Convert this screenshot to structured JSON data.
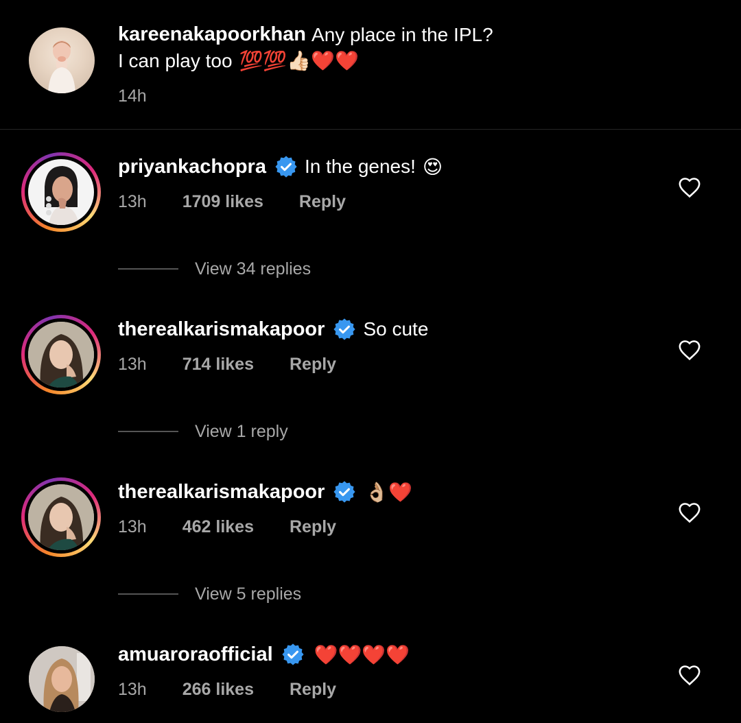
{
  "caption": {
    "username": "kareenakapoorkhan",
    "text_line1": "Any place in the IPL?",
    "text_line2": "I can play too",
    "emojis": "💯💯👍🏻❤️❤️",
    "time": "14h"
  },
  "comments": [
    {
      "username": "priyankachopra",
      "verified": true,
      "text": "In the genes!",
      "emoji": "😍",
      "time": "13h",
      "likes": "1709 likes",
      "reply_label": "Reply",
      "view_replies": "View 34 replies"
    },
    {
      "username": "therealkarismakapoor",
      "verified": true,
      "text": "So cute",
      "emoji": "",
      "time": "13h",
      "likes": "714 likes",
      "reply_label": "Reply",
      "view_replies": "View 1 reply"
    },
    {
      "username": "therealkarismakapoor",
      "verified": true,
      "text": "",
      "emoji": "👌🏼❤️",
      "time": "13h",
      "likes": "462 likes",
      "reply_label": "Reply",
      "view_replies": "View 5 replies"
    },
    {
      "username": "amuaroraofficial",
      "verified": true,
      "text": "",
      "emoji": "❤️❤️❤️❤️",
      "time": "13h",
      "likes": "266 likes",
      "reply_label": "Reply",
      "view_replies": ""
    }
  ],
  "colors": {
    "background": "#000000",
    "secondary_text": "#a8a8a8",
    "verified_blue": "#3897f0"
  },
  "icons": {
    "heart": "heart-outline-icon",
    "verified": "verified-badge-icon"
  }
}
